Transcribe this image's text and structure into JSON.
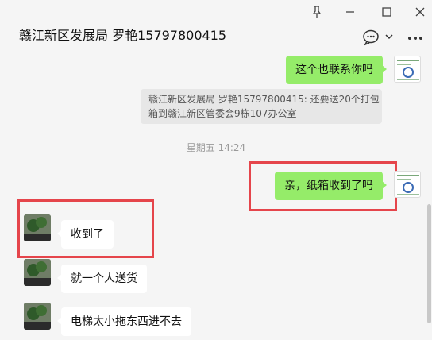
{
  "header": {
    "title": "赣江新区发展局 罗艳15797800415",
    "icons": [
      "pin-icon",
      "minimize-icon",
      "maximize-icon",
      "close-icon",
      "chat-icon",
      "chevron-down-icon",
      "more-icon"
    ]
  },
  "messages": [
    {
      "sender": "me",
      "text": "这个也联系你吗"
    },
    {
      "sender": "quote",
      "lines": [
        "赣江新区发展局 罗艳15797800415: 还要送20个打包",
        "箱到赣江新区管委会9栋107办公室"
      ]
    },
    {
      "sender": "timestamp",
      "text": "星期五 14:24"
    },
    {
      "sender": "me",
      "text": "亲，纸箱收到了吗"
    },
    {
      "sender": "peer",
      "text": "收到了"
    },
    {
      "sender": "peer",
      "text": "就一个人送货"
    },
    {
      "sender": "peer",
      "text": "电梯太小拖东西进不去"
    }
  ],
  "colors": {
    "window_bg": "#f5f5f5",
    "my_bubble": "#95ec69",
    "peer_bubble": "#ffffff",
    "quote_bg": "#e7e7e7",
    "highlight": "#e5454b"
  }
}
